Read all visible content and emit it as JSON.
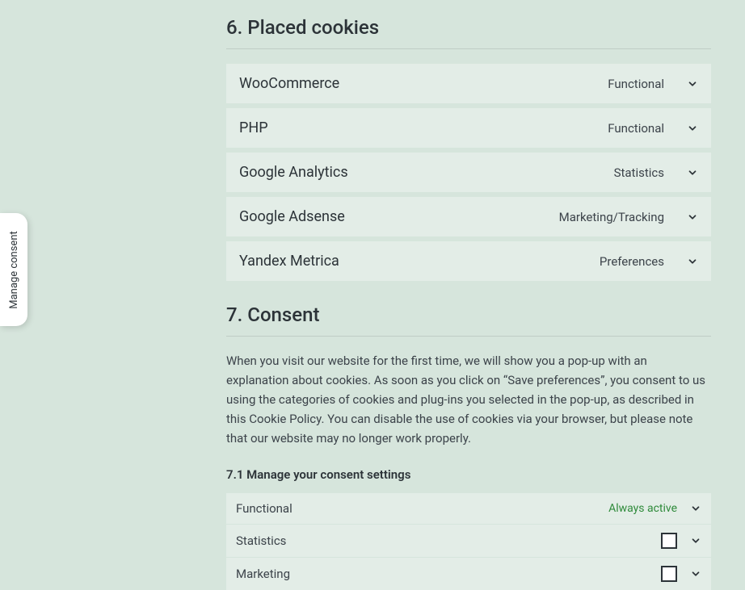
{
  "sections": {
    "placed_cookies": {
      "heading": "6. Placed cookies",
      "items": [
        {
          "name": "WooCommerce",
          "category": "Functional"
        },
        {
          "name": "PHP",
          "category": "Functional"
        },
        {
          "name": "Google Analytics",
          "category": "Statistics"
        },
        {
          "name": "Google Adsense",
          "category": "Marketing/Tracking"
        },
        {
          "name": "Yandex Metrica",
          "category": "Preferences"
        }
      ]
    },
    "consent": {
      "heading": "7. Consent",
      "body": "When you visit our website for the first time, we will show you a pop-up with an explanation about cookies. As soon as you click on “Save preferences”, you consent to us using the categories of cookies and plug-ins you selected in the pop-up, as described in this Cookie Policy. You can disable the use of cookies via your browser, but please note that our website may no longer work properly.",
      "sub_heading": "7.1 Manage your consent settings",
      "rows": [
        {
          "label": "Functional",
          "status": "Always active",
          "checkbox": false
        },
        {
          "label": "Statistics",
          "status": "",
          "checkbox": true
        },
        {
          "label": "Marketing",
          "status": "",
          "checkbox": true
        }
      ]
    }
  },
  "side_tab": {
    "label": "Manage consent"
  }
}
